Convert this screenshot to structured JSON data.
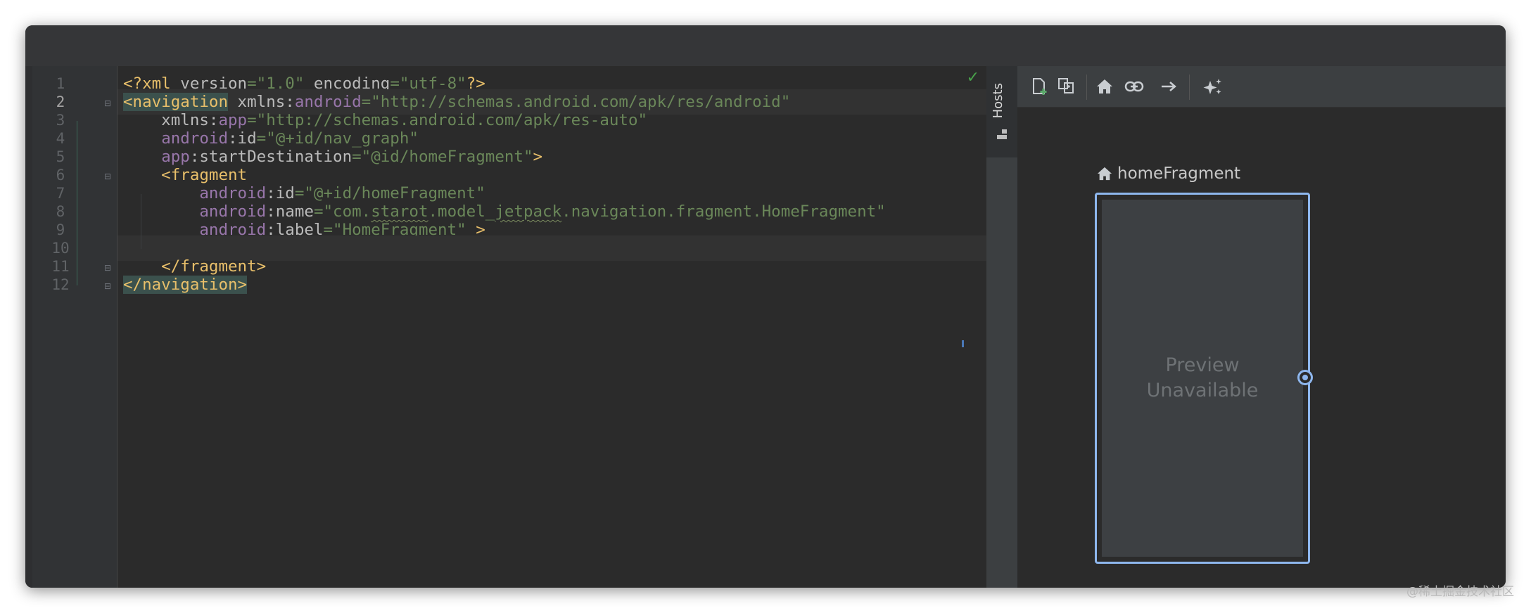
{
  "editor": {
    "line_numbers": [
      "1",
      "2",
      "3",
      "4",
      "5",
      "6",
      "7",
      "8",
      "9",
      "10",
      "11",
      "12"
    ],
    "lines": [
      [
        {
          "c": "pi",
          "t": "<?xml "
        },
        {
          "c": "attr",
          "t": "version"
        },
        {
          "c": "str",
          "t": "=\"1.0\""
        },
        {
          "c": "attr",
          "t": " encoding"
        },
        {
          "c": "str",
          "t": "=\"utf-8\""
        },
        {
          "c": "pi",
          "t": "?>"
        }
      ],
      [
        {
          "c": "t tag-hl",
          "t": "<navigation"
        },
        {
          "c": "attr",
          "t": " xmlns:"
        },
        {
          "c": "ns",
          "t": "android"
        },
        {
          "c": "str",
          "t": "=\"http://schemas.android.com/apk/res/android\""
        }
      ],
      [
        {
          "c": "attr",
          "t": "    xmlns:"
        },
        {
          "c": "ns",
          "t": "app"
        },
        {
          "c": "str",
          "t": "=\"http://schemas.android.com/apk/res-auto\""
        }
      ],
      [
        {
          "c": "attr",
          "t": "    "
        },
        {
          "c": "ns",
          "t": "android"
        },
        {
          "c": "attr",
          "t": ":id"
        },
        {
          "c": "str",
          "t": "=\"@+id/nav_graph\""
        }
      ],
      [
        {
          "c": "attr",
          "t": "    "
        },
        {
          "c": "ns",
          "t": "app"
        },
        {
          "c": "attr",
          "t": ":startDestination"
        },
        {
          "c": "str",
          "t": "=\"@id/homeFragment\""
        },
        {
          "c": "t",
          "t": ">"
        }
      ],
      [
        {
          "c": "t",
          "t": "    <fragment"
        }
      ],
      [
        {
          "c": "attr",
          "t": "        "
        },
        {
          "c": "ns",
          "t": "android"
        },
        {
          "c": "attr",
          "t": ":id"
        },
        {
          "c": "str",
          "t": "=\"@+id/homeFragment\""
        }
      ],
      [
        {
          "c": "attr",
          "t": "        "
        },
        {
          "c": "ns",
          "t": "android"
        },
        {
          "c": "attr",
          "t": ":name"
        },
        {
          "c": "str",
          "t": "=\"com."
        },
        {
          "c": "str squig",
          "t": "starot"
        },
        {
          "c": "str",
          "t": ".model_"
        },
        {
          "c": "str squig",
          "t": "jetpack"
        },
        {
          "c": "str",
          "t": ".navigation.fragment.HomeFragment\""
        }
      ],
      [
        {
          "c": "attr",
          "t": "        "
        },
        {
          "c": "ns",
          "t": "android"
        },
        {
          "c": "attr",
          "t": ":label"
        },
        {
          "c": "str",
          "t": "=\"HomeFragment\""
        },
        {
          "c": "t",
          "t": " >"
        }
      ],
      [
        {
          "c": "attr",
          "t": ""
        }
      ],
      [
        {
          "c": "t",
          "t": "    </fragment>"
        }
      ],
      [
        {
          "c": "t tag-hl",
          "t": "</navigation>"
        }
      ]
    ]
  },
  "hosts_tab": {
    "label": "Hosts"
  },
  "toolbar": {
    "buttons": [
      "new-destination-icon",
      "new-nested-graph-icon",
      "assign-start-destination-icon",
      "deep-link-icon",
      "add-action-icon",
      "auto-arrange-icon"
    ]
  },
  "destination": {
    "name": "homeFragment",
    "preview_text": "Preview\nUnavailable"
  },
  "watermark": "@稀土掘金技术社区",
  "colors": {
    "tag": "#e8bf6a",
    "attribute": "#bababa",
    "namespace": "#9876aa",
    "string": "#6a8759",
    "selection_border": "#8eb7ee"
  }
}
